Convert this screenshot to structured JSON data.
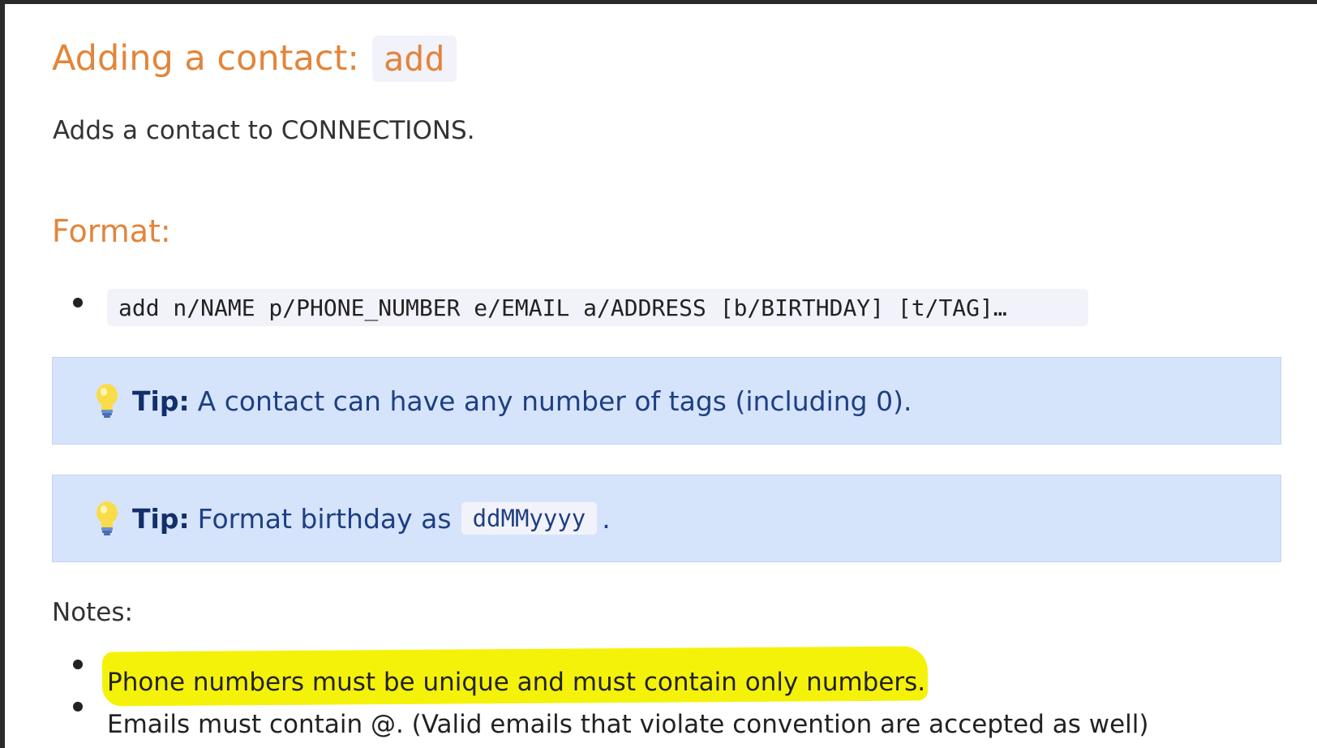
{
  "heading": {
    "text": "Adding a contact:",
    "command": "add"
  },
  "description": "Adds a contact to CONNECTIONS.",
  "format": {
    "heading": "Format:",
    "command": "add n/NAME p/PHONE_NUMBER e/EMAIL a/ADDRESS [b/BIRTHDAY] [t/TAG]…"
  },
  "tips": [
    {
      "label": "Tip:",
      "text": "A contact can have any number of tags (including 0)."
    },
    {
      "label": "Tip:",
      "text": "Format birthday as",
      "code": "ddMMyyyy",
      "suffix": "."
    }
  ],
  "notes": {
    "heading": "Notes:",
    "items": [
      "Phone numbers must be unique and must contain only numbers.",
      "Emails must contain @. (Valid emails that violate convention are accepted as well)"
    ]
  },
  "colors": {
    "heading": "#e2853a",
    "tip_background": "#d5e4fb",
    "tip_text": "#1e3f82",
    "highlight": "#f5f20a",
    "code_background": "#f2f2fb"
  },
  "icons": {
    "tip": "lightbulb-icon",
    "list_marker": "bullet-icon"
  }
}
